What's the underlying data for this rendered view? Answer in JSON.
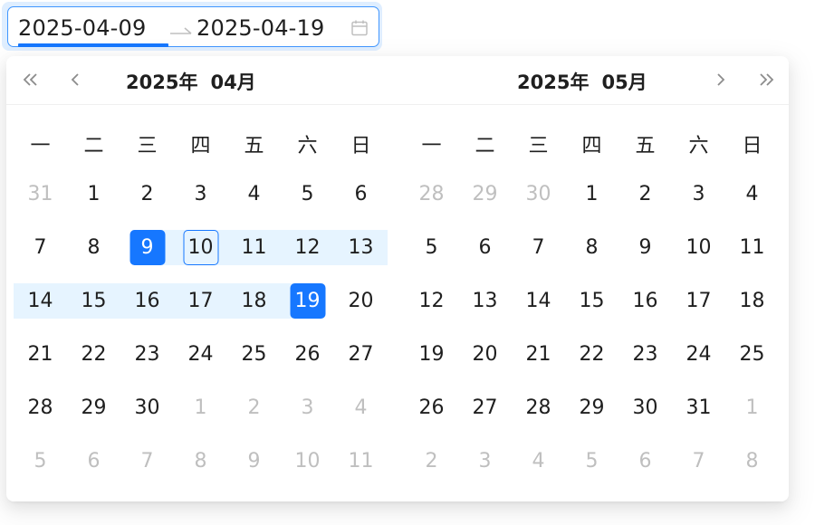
{
  "range": {
    "start": "2025-04-09",
    "end": "2025-04-19"
  },
  "colors": {
    "accent": "#1677ff",
    "range_bg": "#e6f4ff",
    "muted": "#bfbfbf",
    "text": "#1f1f1f"
  },
  "icons": {
    "super_prev": "double-chevron-left-icon",
    "prev": "chevron-left-icon",
    "next": "chevron-right-icon",
    "super_next": "double-chevron-right-icon",
    "calendar": "calendar-icon",
    "arrow": "arrow-right-icon"
  },
  "weekdays": [
    "一",
    "二",
    "三",
    "四",
    "五",
    "六",
    "日"
  ],
  "months": [
    {
      "year_label": "2025年",
      "month_label": "04月",
      "weeks": [
        [
          {
            "d": "31",
            "out": true
          },
          {
            "d": "1"
          },
          {
            "d": "2"
          },
          {
            "d": "3"
          },
          {
            "d": "4"
          },
          {
            "d": "5"
          },
          {
            "d": "6"
          }
        ],
        [
          {
            "d": "7"
          },
          {
            "d": "8"
          },
          {
            "d": "9",
            "state": "range-start"
          },
          {
            "d": "10",
            "state": "today-in-range"
          },
          {
            "d": "11",
            "state": "in-range"
          },
          {
            "d": "12",
            "state": "in-range"
          },
          {
            "d": "13",
            "state": "in-range"
          }
        ],
        [
          {
            "d": "14",
            "state": "in-range"
          },
          {
            "d": "15",
            "state": "in-range"
          },
          {
            "d": "16",
            "state": "in-range"
          },
          {
            "d": "17",
            "state": "in-range"
          },
          {
            "d": "18",
            "state": "in-range"
          },
          {
            "d": "19",
            "state": "range-end"
          },
          {
            "d": "20"
          }
        ],
        [
          {
            "d": "21"
          },
          {
            "d": "22"
          },
          {
            "d": "23"
          },
          {
            "d": "24"
          },
          {
            "d": "25"
          },
          {
            "d": "26"
          },
          {
            "d": "27"
          }
        ],
        [
          {
            "d": "28"
          },
          {
            "d": "29"
          },
          {
            "d": "30"
          },
          {
            "d": "1",
            "out": true
          },
          {
            "d": "2",
            "out": true
          },
          {
            "d": "3",
            "out": true
          },
          {
            "d": "4",
            "out": true
          }
        ],
        [
          {
            "d": "5",
            "out": true
          },
          {
            "d": "6",
            "out": true
          },
          {
            "d": "7",
            "out": true
          },
          {
            "d": "8",
            "out": true
          },
          {
            "d": "9",
            "out": true
          },
          {
            "d": "10",
            "out": true
          },
          {
            "d": "11",
            "out": true
          }
        ]
      ]
    },
    {
      "year_label": "2025年",
      "month_label": "05月",
      "weeks": [
        [
          {
            "d": "28",
            "out": true
          },
          {
            "d": "29",
            "out": true
          },
          {
            "d": "30",
            "out": true
          },
          {
            "d": "1"
          },
          {
            "d": "2"
          },
          {
            "d": "3"
          },
          {
            "d": "4"
          }
        ],
        [
          {
            "d": "5"
          },
          {
            "d": "6"
          },
          {
            "d": "7"
          },
          {
            "d": "8"
          },
          {
            "d": "9"
          },
          {
            "d": "10"
          },
          {
            "d": "11"
          }
        ],
        [
          {
            "d": "12"
          },
          {
            "d": "13"
          },
          {
            "d": "14"
          },
          {
            "d": "15"
          },
          {
            "d": "16"
          },
          {
            "d": "17"
          },
          {
            "d": "18"
          }
        ],
        [
          {
            "d": "19"
          },
          {
            "d": "20"
          },
          {
            "d": "21"
          },
          {
            "d": "22"
          },
          {
            "d": "23"
          },
          {
            "d": "24"
          },
          {
            "d": "25"
          }
        ],
        [
          {
            "d": "26"
          },
          {
            "d": "27"
          },
          {
            "d": "28"
          },
          {
            "d": "29"
          },
          {
            "d": "30"
          },
          {
            "d": "31"
          },
          {
            "d": "1",
            "out": true
          }
        ],
        [
          {
            "d": "2",
            "out": true
          },
          {
            "d": "3",
            "out": true
          },
          {
            "d": "4",
            "out": true
          },
          {
            "d": "5",
            "out": true
          },
          {
            "d": "6",
            "out": true
          },
          {
            "d": "7",
            "out": true
          },
          {
            "d": "8",
            "out": true
          }
        ]
      ]
    }
  ]
}
